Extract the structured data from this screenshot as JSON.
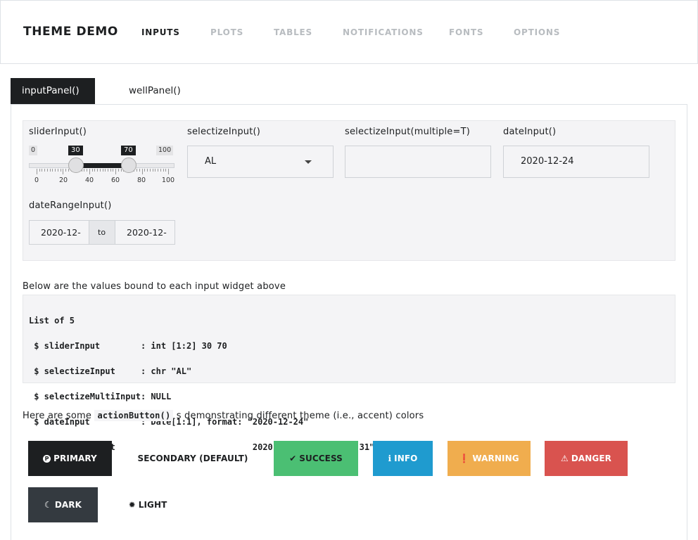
{
  "navbar": {
    "brand": "THEME DEMO",
    "items": [
      "INPUTS",
      "PLOTS",
      "TABLES",
      "NOTIFICATIONS",
      "FONTS",
      "OPTIONS"
    ],
    "active_index": 0
  },
  "tabs": [
    "inputPanel()",
    "wellPanel()"
  ],
  "labels": {
    "slider": "sliderInput()",
    "selectize": "selectizeInput()",
    "selectize_multi": "selectizeInput(multiple=T)",
    "date": "dateInput()",
    "daterange": "dateRangeInput()"
  },
  "slider": {
    "min": 0,
    "max": 100,
    "min_label": "0",
    "max_label": "100",
    "from": 30,
    "to": 70,
    "from_label": "30",
    "to_label": "70",
    "ticks": [
      "0",
      "20",
      "40",
      "60",
      "80",
      "100"
    ]
  },
  "selectize": {
    "value": "AL"
  },
  "selectize_multi": {
    "value": ""
  },
  "date": {
    "value": "2020-12-24"
  },
  "daterange": {
    "start": "2020-12-",
    "sep": "to",
    "end": "2020-12-"
  },
  "values_description": "Below are the values bound to each input widget above",
  "values_output": [
    "List of 5",
    " $ sliderInput        : int [1:2] 30 70",
    " $ selectizeInput     : chr \"AL\"",
    " $ selectizeMultiInput: NULL",
    " $ dateInput          : Date[1:1], format: \"2020-12-24\"",
    " $ dateRangeInput     : Date[1:2], format: \"2020-12-24\" \"2020-12-31\""
  ],
  "buttons_text": {
    "before": "Here are some ",
    "code": "actionButton()",
    "after": " s demonstrating different theme (i.e., accent) colors"
  },
  "buttons": {
    "primary": {
      "label": "PRIMARY",
      "icon": "p-circle-icon",
      "color": "#1d1f21"
    },
    "secondary": {
      "label": "SECONDARY (DEFAULT)",
      "color": "#ffffff"
    },
    "success": {
      "label": "SUCCESS",
      "icon": "check-icon",
      "color": "#4bbf73"
    },
    "info": {
      "label": "INFO",
      "icon": "info-icon",
      "color": "#1f9bcf"
    },
    "warning": {
      "label": "WARNING",
      "icon": "exclamation-icon",
      "color": "#f0ad4e"
    },
    "danger": {
      "label": "DANGER",
      "icon": "warning-triangle-icon",
      "color": "#d9534f"
    },
    "dark": {
      "label": "DARK",
      "icon": "moon-icon",
      "color": "#343a40"
    },
    "light": {
      "label": "LIGHT",
      "icon": "sun-icon",
      "color": "#ffffff"
    }
  }
}
